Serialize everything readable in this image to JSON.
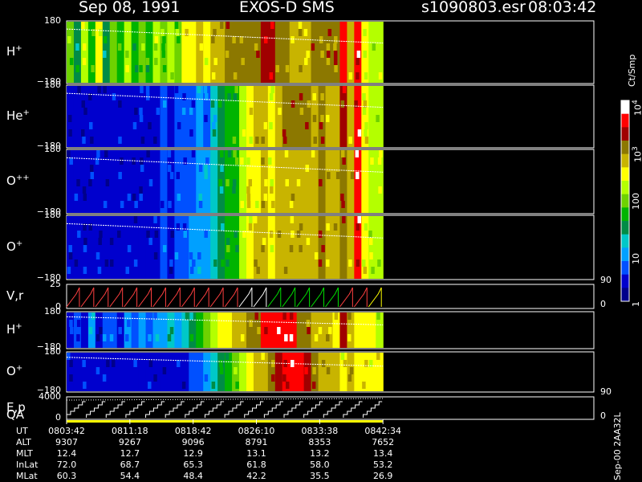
{
  "header": {
    "date": "Sep 08, 1991",
    "mission": "EXOS-D SMS",
    "file": "s1090803.esr",
    "time": "08:03:42"
  },
  "panels": [
    {
      "label": "H",
      "sup": "+",
      "top": "180",
      "bottom": "−180"
    },
    {
      "label": "He",
      "sup": "+",
      "top": "180",
      "bottom": "−180"
    },
    {
      "label": "O",
      "sup": "++",
      "top": "180",
      "bottom": "−180"
    },
    {
      "label": "O",
      "sup": "+",
      "top": "180",
      "bottom": "−180"
    },
    {
      "label": "V,r",
      "sup": "",
      "top": "25",
      "bottom": "0"
    },
    {
      "label": "H",
      "sup": "+",
      "top": "180",
      "bottom": "−180"
    },
    {
      "label": "O",
      "sup": "+",
      "top": "180",
      "bottom": "−180"
    },
    {
      "label": "E,p",
      "sup": "",
      "top": "4000",
      "bottom": "0"
    }
  ],
  "qa_label": "QA",
  "right_axis": {
    "vr_top": "90",
    "vr_bottom": "0",
    "ep_top": "90",
    "ep_bottom": "0"
  },
  "colorbar": {
    "unit": "Ct/Smp",
    "ticks": [
      {
        "label": "1",
        "sup": ""
      },
      {
        "label": "10",
        "sup": ""
      },
      {
        "label": "100",
        "sup": ""
      },
      {
        "label": "10",
        "sup": "3"
      },
      {
        "label": "10",
        "sup": "4"
      }
    ],
    "colors": [
      "#00008b",
      "#0000cd",
      "#0050ff",
      "#00a0ff",
      "#00c8c8",
      "#008c46",
      "#00b400",
      "#6ed200",
      "#b4ff00",
      "#ffff00",
      "#c8b400",
      "#8c7800",
      "#a00000",
      "#ff0000",
      "#ffffff"
    ]
  },
  "side_stamp": "Sep-00  2AA32L",
  "table": {
    "row_labels": [
      "UT",
      "ALT",
      "MLT",
      "InLat",
      "MLat"
    ],
    "columns": [
      [
        "0803:42",
        "9307",
        "12.4",
        "72.0",
        "60.3"
      ],
      [
        "0811:18",
        "9267",
        "12.7",
        "68.7",
        "54.4"
      ],
      [
        "0818:42",
        "9096",
        "12.9",
        "65.3",
        "48.4"
      ],
      [
        "0826:10",
        "8791",
        "13.1",
        "61.8",
        "42.2"
      ],
      [
        "0833:38",
        "8353",
        "13.2",
        "58.0",
        "35.5"
      ],
      [
        "0842:34",
        "7652",
        "13.4",
        "53.2",
        "26.9"
      ]
    ]
  },
  "chart_data": {
    "type": "heatmap",
    "x_ticks": [
      "0803:42",
      "0811:18",
      "0818:42",
      "0826:10",
      "0833:38",
      "0842:34"
    ],
    "data_end_fraction": 0.6,
    "color_scale": [
      "1",
      "10",
      "100",
      "10^3",
      "10^4"
    ],
    "color_unit": "Ct/Smp",
    "series": [
      {
        "name": "H+",
        "ylim": [
          -180,
          180
        ],
        "levels": [
          7,
          5,
          8,
          6,
          9,
          5,
          7,
          6,
          8,
          6,
          7,
          6,
          8,
          7,
          8,
          7,
          9,
          9,
          10,
          9,
          10,
          10,
          11,
          11,
          11,
          11,
          11,
          12,
          12,
          11,
          11,
          10,
          10,
          10,
          11,
          11,
          11,
          11,
          13,
          10,
          13,
          9,
          8,
          8
        ]
      },
      {
        "name": "He+",
        "ylim": [
          -180,
          180
        ],
        "levels": [
          1,
          1,
          1,
          1,
          1,
          1,
          1,
          1,
          1,
          1,
          1,
          1,
          1,
          2,
          1,
          2,
          2,
          2,
          3,
          2,
          4,
          5,
          6,
          6,
          8,
          9,
          10,
          10,
          9,
          10,
          11,
          11,
          11,
          11,
          10,
          11,
          10,
          10,
          12,
          10,
          13,
          9,
          8,
          8
        ]
      },
      {
        "name": "O++",
        "ylim": [
          -180,
          180
        ],
        "levels": [
          1,
          1,
          1,
          1,
          1,
          1,
          1,
          1,
          1,
          1,
          1,
          1,
          1,
          2,
          1,
          2,
          2,
          2,
          3,
          3,
          4,
          5,
          6,
          6,
          8,
          9,
          9,
          10,
          9,
          10,
          10,
          10,
          10,
          10,
          10,
          11,
          10,
          10,
          11,
          10,
          13,
          9,
          8,
          8
        ]
      },
      {
        "name": "O+",
        "ylim": [
          -180,
          180
        ],
        "levels": [
          1,
          1,
          1,
          1,
          1,
          1,
          1,
          1,
          1,
          1,
          1,
          1,
          1,
          2,
          1,
          2,
          2,
          3,
          3,
          3,
          4,
          5,
          6,
          6,
          8,
          9,
          10,
          10,
          9,
          10,
          10,
          10,
          10,
          10,
          10,
          11,
          10,
          10,
          11,
          10,
          13,
          9,
          8,
          8
        ]
      },
      {
        "name": "H+ (2)",
        "ylim": [
          -180,
          180
        ],
        "levels": [
          1,
          2,
          1,
          3,
          1,
          2,
          2,
          1,
          3,
          2,
          3,
          2,
          3,
          3,
          4,
          3,
          4,
          5,
          6,
          7,
          8,
          9,
          9,
          10,
          10,
          11,
          11,
          13,
          13,
          13,
          13,
          13,
          11,
          11,
          10,
          10,
          10,
          9,
          12,
          10,
          9,
          9,
          9,
          8
        ]
      },
      {
        "name": "O+ (2)",
        "ylim": [
          -180,
          180
        ],
        "levels": [
          1,
          1,
          1,
          1,
          1,
          1,
          1,
          1,
          1,
          1,
          1,
          1,
          1,
          1,
          1,
          1,
          1,
          2,
          2,
          3,
          4,
          5,
          6,
          7,
          8,
          9,
          10,
          10,
          11,
          12,
          13,
          13,
          13,
          12,
          11,
          10,
          10,
          10,
          9,
          10,
          9,
          9,
          9,
          9
        ]
      }
    ],
    "line_panels": [
      {
        "name": "V,r",
        "ylim": [
          0,
          25
        ],
        "right_ylim": [
          0,
          90
        ]
      },
      {
        "name": "E,p",
        "ylim": [
          0,
          4000
        ],
        "right_ylim": [
          0,
          90
        ]
      }
    ]
  }
}
